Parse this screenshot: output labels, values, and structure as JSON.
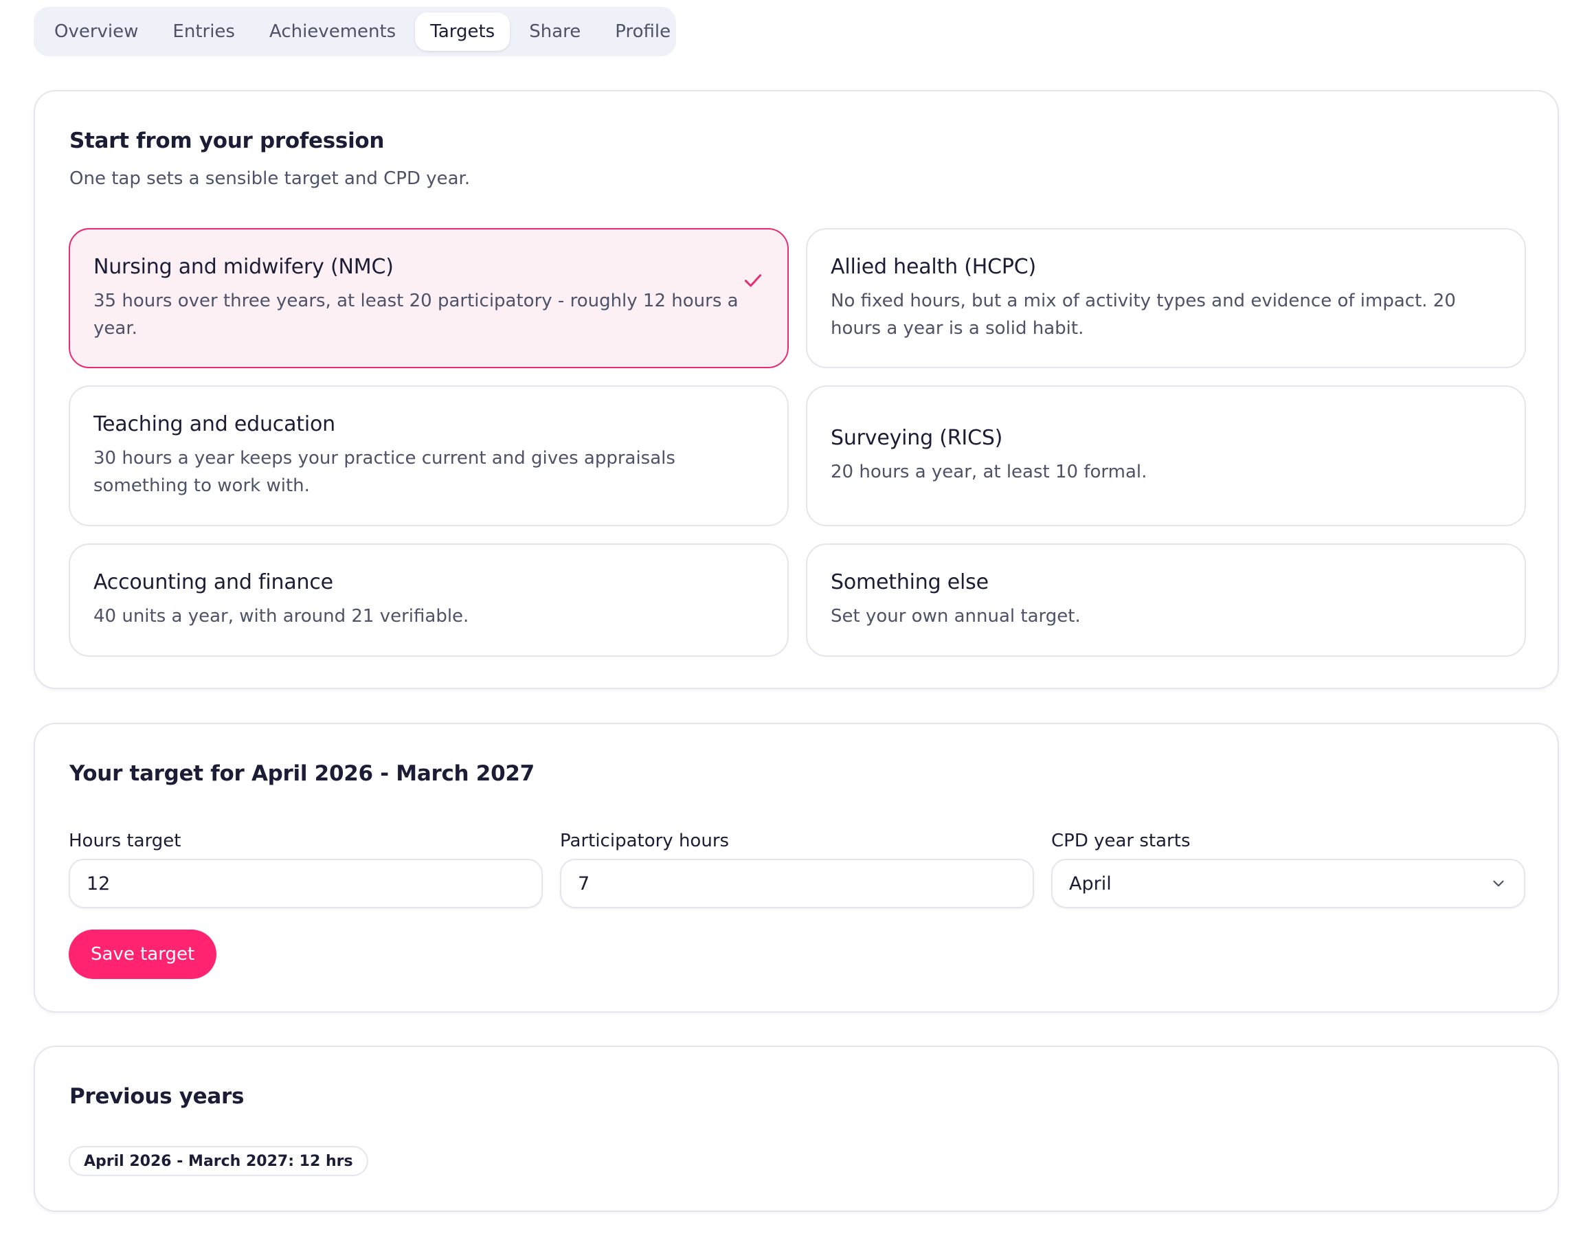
{
  "nav": {
    "tabs": [
      {
        "label": "Overview"
      },
      {
        "label": "Entries"
      },
      {
        "label": "Achievements"
      },
      {
        "label": "Targets",
        "active": true
      },
      {
        "label": "Share"
      },
      {
        "label": "Profile"
      }
    ]
  },
  "profession": {
    "title": "Start from your profession",
    "subtitle": "One tap sets a sensible target and CPD year.",
    "options": [
      {
        "title": "Nursing and midwifery (NMC)",
        "desc": "35 hours over three years, at least 20 participatory - roughly 12 hours a year.",
        "selected": true
      },
      {
        "title": "Allied health (HCPC)",
        "desc": "No fixed hours, but a mix of activity types and evidence of impact. 20 hours a year is a solid habit."
      },
      {
        "title": "Teaching and education",
        "desc": "30 hours a year keeps your practice current and gives appraisals something to work with."
      },
      {
        "title": "Surveying (RICS)",
        "desc": "20 hours a year, at least 10 formal."
      },
      {
        "title": "Accounting and finance",
        "desc": "40 units a year, with around 21 verifiable."
      },
      {
        "title": "Something else",
        "desc": "Set your own annual target."
      }
    ]
  },
  "target": {
    "title": "Your target for April 2026 - March 2027",
    "hours_label": "Hours target",
    "hours_value": "12",
    "participatory_label": "Participatory hours",
    "participatory_value": "7",
    "year_start_label": "CPD year starts",
    "year_start_value": "April",
    "save_label": "Save target"
  },
  "previous": {
    "title": "Previous years",
    "chips": [
      "April 2026 - March 2027: 12 hrs"
    ]
  },
  "colors": {
    "accent": "#ff2370",
    "selected_border": "#ea2a72",
    "selected_bg": "#fdf0f5",
    "tab_bar_bg": "#eef1f7"
  }
}
